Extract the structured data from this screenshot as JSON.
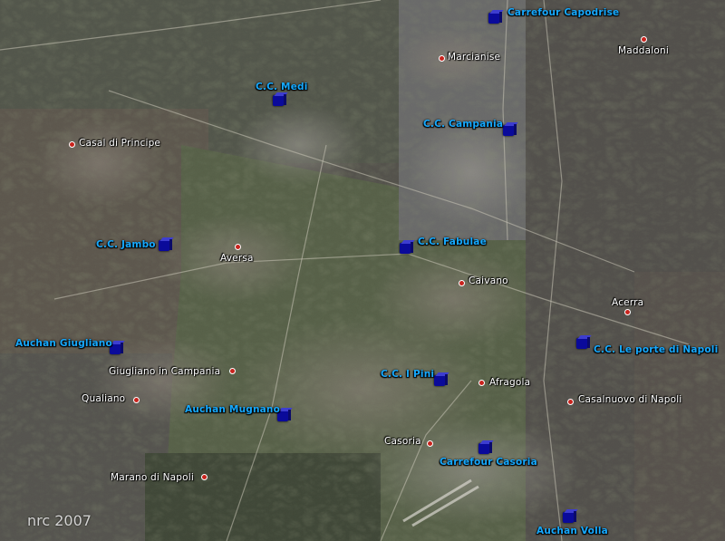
{
  "colors": {
    "mall_label": "#16a9ff",
    "town_label": "#ffffff",
    "town_marker": "#c8231d",
    "mall_marker": "#0a0a9a"
  },
  "icons": {
    "town": "red-dot-icon",
    "mall": "blue-cube-icon"
  },
  "watermark": "nrc 2007",
  "towns": {
    "marcianise": "Marcianise",
    "maddaloni": "Maddaloni",
    "casal_di_principe": "Casal di Principe",
    "aversa": "Aversa",
    "caivano": "Caivano",
    "acerra": "Acerra",
    "giugliano": "Giugliano in Campania",
    "qualiano": "Qualiano",
    "afragola": "Afragola",
    "casalnuovo": "Casalnuovo di Napoli",
    "casoria": "Casoria",
    "marano": "Marano di Napoli"
  },
  "malls": {
    "carrefour_capodrise": "Carrefour Capodrise",
    "cc_medi": "C.C. Medi",
    "cc_campania": "C.C. Campania",
    "cc_jambo": "C.C. Jambo",
    "cc_fabulae": "C.C. Fabulae",
    "auchan_giugliano": "Auchan Giugliano",
    "cc_le_porte": "C.C. Le porte di Napoli",
    "cc_i_pini": "C.C. I Pini",
    "auchan_mugnano": "Auchan Mugnano",
    "carrefour_casoria": "Carrefour Casoria",
    "auchan_volla": "Auchan Volla"
  }
}
